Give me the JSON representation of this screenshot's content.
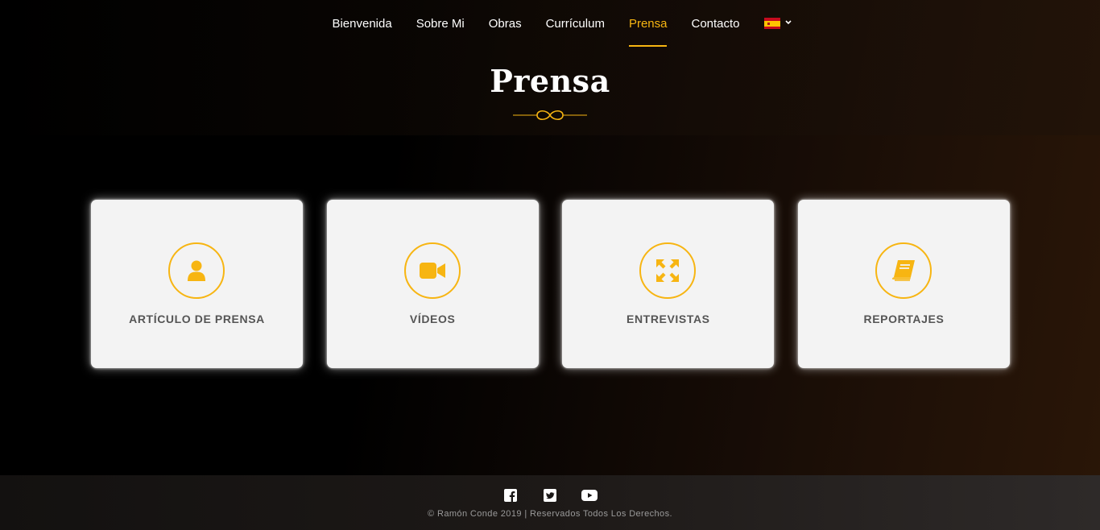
{
  "nav": {
    "items": [
      {
        "label": "Bienvenida",
        "active": false
      },
      {
        "label": "Sobre Mi",
        "active": false
      },
      {
        "label": "Obras",
        "active": false
      },
      {
        "label": "Currículum",
        "active": false
      },
      {
        "label": "Prensa",
        "active": true
      },
      {
        "label": "Contacto",
        "active": false
      }
    ],
    "language_icon": "spain-flag-icon"
  },
  "page": {
    "title": "Prensa"
  },
  "cards": [
    {
      "label": "ARTÍCULO DE PRENSA",
      "icon": "user-icon"
    },
    {
      "label": "VÍDEOS",
      "icon": "video-camera-icon"
    },
    {
      "label": "ENTREVISTAS",
      "icon": "arrows-expand-icon"
    },
    {
      "label": "REPORTAJES",
      "icon": "book-icon"
    }
  ],
  "footer": {
    "social": [
      "facebook-icon",
      "twitter-icon",
      "youtube-icon"
    ],
    "copyright": "© Ramón Conde 2019 | Reservados Todos Los Derechos."
  },
  "colors": {
    "accent": "#f7b512",
    "card_bg": "#f3f3f3",
    "card_text": "#555555"
  }
}
